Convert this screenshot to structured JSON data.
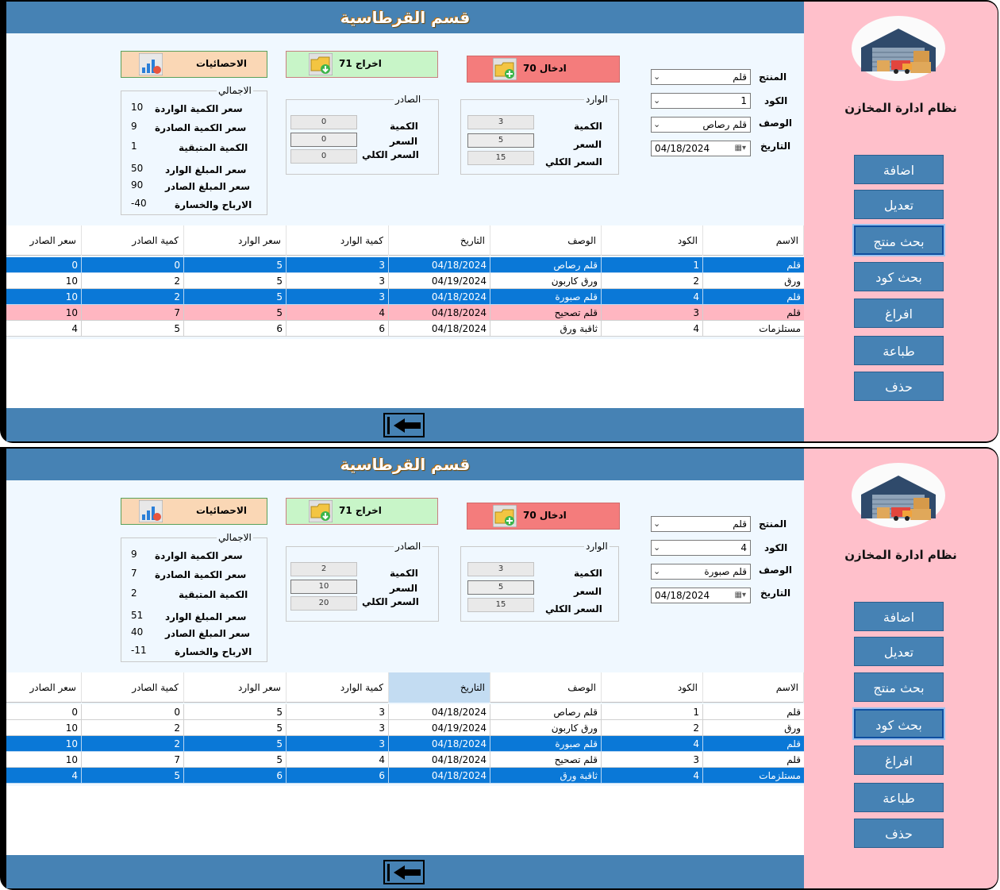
{
  "app": {
    "name": "نظام ادارة المخازن",
    "section_title": "قسم القرطاسية",
    "nav": [
      "اضافة",
      "تعديل",
      "بحث منتج",
      "بحث كود",
      "افراغ",
      "طباعة",
      "حذف"
    ]
  },
  "form_labels": {
    "product": "المنتج",
    "code": "الكود",
    "description": "الوصف",
    "date": "التاريخ",
    "incoming_group": "الوارد",
    "outgoing_group": "الصادر",
    "total_group": "الاجمالي",
    "qty": "الكمية",
    "price": "السعر",
    "total_price": "السعر الكلي",
    "stats_button": "الاحصائيات",
    "stat_in_qty": "سعر الكمية الواردة",
    "stat_out_qty": "سعر الكمية الصادرة",
    "stat_remaining": "الكمية المتبقية",
    "stat_in_amount": "سعر المبلغ الوارد",
    "stat_out_amount": "سعر المبلغ الصادر",
    "stat_profit": "الارباح والخسارة"
  },
  "table_headers": [
    "الاسم",
    "الكود",
    "الوصف",
    "التاريخ",
    "كمية الوارد",
    "سعر الوارد",
    "كمية الصادر",
    "سعر الصادر"
  ],
  "colors": {
    "accent": "#4682b4",
    "sidebar": "#ffc0cb",
    "selected_row": "#0a78d7",
    "highlight_row": "#ffb6c1",
    "entry_button": "#f47c7c",
    "exit_button": "#c8f5c8",
    "stats_button": "#fad7b5"
  },
  "windows": [
    {
      "product": "قلم",
      "code": "1",
      "description": "قلم رصاص",
      "date": "04/18/2024",
      "entry_button": "ادخال 70",
      "exit_button": "اخراج 71",
      "in": {
        "qty": "3",
        "price": "5",
        "total": "15"
      },
      "out": {
        "qty": "0",
        "price": "0",
        "total": "0"
      },
      "stats": {
        "in_qty": "10",
        "out_qty": "9",
        "remaining": "1",
        "in_amount": "50",
        "out_amount": "90",
        "profit": "-40"
      },
      "active_nav": 2,
      "selected_header": -1,
      "rows": [
        {
          "name": "قلم",
          "code": "1",
          "desc": "قلم رصاص",
          "date": "04/18/2024",
          "in_qty": "3",
          "in_price": "5",
          "out_qty": "0",
          "out_price": "0",
          "state": "sel"
        },
        {
          "name": "ورق",
          "code": "2",
          "desc": "ورق كاربون",
          "date": "04/19/2024",
          "in_qty": "3",
          "in_price": "5",
          "out_qty": "2",
          "out_price": "10",
          "state": ""
        },
        {
          "name": "قلم",
          "code": "4",
          "desc": "قلم صبورة",
          "date": "04/18/2024",
          "in_qty": "3",
          "in_price": "5",
          "out_qty": "2",
          "out_price": "10",
          "state": "sel"
        },
        {
          "name": "قلم",
          "code": "3",
          "desc": "قلم تصحيح",
          "date": "04/18/2024",
          "in_qty": "4",
          "in_price": "5",
          "out_qty": "7",
          "out_price": "10",
          "state": "pink"
        },
        {
          "name": "مستلزمات",
          "code": "4",
          "desc": "ثاقبة ورق",
          "date": "04/18/2024",
          "in_qty": "6",
          "in_price": "6",
          "out_qty": "5",
          "out_price": "4",
          "state": ""
        }
      ]
    },
    {
      "product": "قلم",
      "code": "4",
      "description": "قلم صبورة",
      "date": "04/18/2024",
      "entry_button": "ادخال 70",
      "exit_button": "اخراج 71",
      "in": {
        "qty": "3",
        "price": "5",
        "total": "15"
      },
      "out": {
        "qty": "2",
        "price": "10",
        "total": "20"
      },
      "stats": {
        "in_qty": "9",
        "out_qty": "7",
        "remaining": "2",
        "in_amount": "51",
        "out_amount": "40",
        "profit": "-11"
      },
      "active_nav": 3,
      "selected_header": 3,
      "rows": [
        {
          "name": "قلم",
          "code": "1",
          "desc": "قلم رصاص",
          "date": "04/18/2024",
          "in_qty": "3",
          "in_price": "5",
          "out_qty": "0",
          "out_price": "0",
          "state": ""
        },
        {
          "name": "ورق",
          "code": "2",
          "desc": "ورق كاربون",
          "date": "04/19/2024",
          "in_qty": "3",
          "in_price": "5",
          "out_qty": "2",
          "out_price": "10",
          "state": ""
        },
        {
          "name": "قلم",
          "code": "4",
          "desc": "قلم صبورة",
          "date": "04/18/2024",
          "in_qty": "3",
          "in_price": "5",
          "out_qty": "2",
          "out_price": "10",
          "state": "sel"
        },
        {
          "name": "قلم",
          "code": "3",
          "desc": "قلم تصحيح",
          "date": "04/18/2024",
          "in_qty": "4",
          "in_price": "5",
          "out_qty": "7",
          "out_price": "10",
          "state": ""
        },
        {
          "name": "مستلزمات",
          "code": "4",
          "desc": "ثاقبة ورق",
          "date": "04/18/2024",
          "in_qty": "6",
          "in_price": "6",
          "out_qty": "5",
          "out_price": "4",
          "state": "sel"
        }
      ]
    }
  ]
}
